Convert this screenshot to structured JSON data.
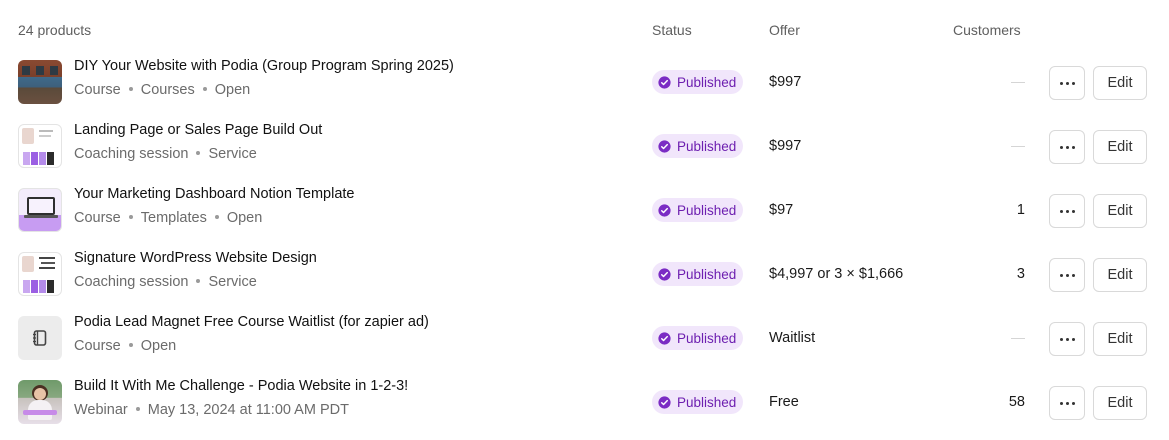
{
  "header": {
    "count_label": "24 products",
    "status_label": "Status",
    "offer_label": "Offer",
    "customers_label": "Customers"
  },
  "actions": {
    "more_icon": "ellipsis-icon",
    "edit_label": "Edit"
  },
  "badge_icon": "check-circle-icon",
  "colors": {
    "badge_bg": "#f1e6fb",
    "badge_text": "#6d1fb0",
    "accent_purple": "#8a3fdb"
  },
  "products": [
    {
      "title": "DIY Your Website with Podia (Group Program Spring 2025)",
      "meta": [
        "Course",
        "Courses",
        "Open"
      ],
      "status": "Published",
      "offer": "$997",
      "customers": "",
      "thumbnail": "brick-building-photo"
    },
    {
      "title": "Landing Page or Sales Page Build Out",
      "meta": [
        "Coaching session",
        "Service"
      ],
      "status": "Published",
      "offer": "$997",
      "customers": "",
      "thumbnail": "brand-color-swatches"
    },
    {
      "title": "Your Marketing Dashboard Notion Template",
      "meta": [
        "Course",
        "Templates",
        "Open"
      ],
      "status": "Published",
      "offer": "$97",
      "customers": "1",
      "thumbnail": "laptop-dashboard-mockup"
    },
    {
      "title": "Signature WordPress Website Design",
      "meta": [
        "Coaching session",
        "Service"
      ],
      "status": "Published",
      "offer": "$4,997 or 3 × $1,666",
      "customers": "3",
      "thumbnail": "brand-color-swatches"
    },
    {
      "title": "Podia Lead Magnet Free Course Waitlist (for zapier ad)",
      "meta": [
        "Course",
        "Open"
      ],
      "status": "Published",
      "offer": "Waitlist",
      "customers": "",
      "thumbnail": "notebook-icon"
    },
    {
      "title": "Build It With Me Challenge - Podia Website in 1-2-3!",
      "meta": [
        "Webinar",
        "May 13, 2024 at 11:00 AM PDT"
      ],
      "status": "Published",
      "offer": "Free",
      "customers": "58",
      "thumbnail": "person-portrait-photo"
    }
  ]
}
